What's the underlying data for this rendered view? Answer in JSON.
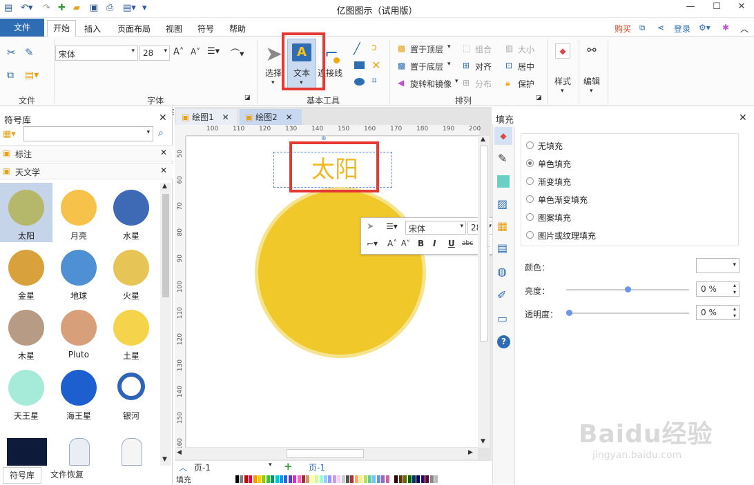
{
  "window": {
    "title": "亿图图示（试用版）",
    "minimize": "—",
    "maximize": "☐",
    "close": "✕"
  },
  "menu": {
    "file": "文件",
    "items": [
      "开始",
      "插入",
      "页面布局",
      "视图",
      "符号",
      "帮助"
    ],
    "buy": "购买",
    "login": "登录"
  },
  "ribbon": {
    "groups": {
      "file": "文件",
      "font": "字体",
      "basic_tools": "基本工具",
      "arrange": "排列"
    },
    "font_name": "宋体",
    "font_size": "28",
    "tools": {
      "select": "选择",
      "text": "文本",
      "connector": "连接线"
    },
    "arrange": {
      "bring_top": "置于顶层",
      "send_bottom": "置于底层",
      "rotate": "旋转和镜像",
      "group": "组合",
      "align": "对齐",
      "distribute": "分布",
      "size": "大小",
      "center": "居中",
      "protect": "保护"
    },
    "style": "样式",
    "edit": "编辑"
  },
  "left_panel": {
    "title": "符号库",
    "search_placeholder": "",
    "libraries": [
      "标注",
      "天文学"
    ],
    "symbols": [
      {
        "label": "太阳",
        "color": "#b5b86a"
      },
      {
        "label": "月亮",
        "color": "#f6c24a"
      },
      {
        "label": "水星",
        "color": "#3e69b4"
      },
      {
        "label": "金星",
        "color": "#d9a13c"
      },
      {
        "label": "地球",
        "color": "#4f8fd4"
      },
      {
        "label": "火星",
        "color": "#e7c456"
      },
      {
        "label": "木星",
        "color": "#b89b85"
      },
      {
        "label": "Pluto",
        "color": "#d8a07a"
      },
      {
        "label": "土星",
        "color": "#f5d34b"
      },
      {
        "label": "天王星",
        "color": "#a6ebd9"
      },
      {
        "label": "海王星",
        "color": "#1e5fcf"
      },
      {
        "label": "银河",
        "color": "#2d64b8"
      }
    ],
    "bottom_tabs": [
      "符号库",
      "文件恢复"
    ]
  },
  "doc_tabs": [
    "绘图1",
    "绘图2"
  ],
  "ruler_h": [
    "100",
    "110",
    "120",
    "130",
    "140",
    "150",
    "160",
    "170",
    "180",
    "190",
    "200"
  ],
  "ruler_v": [
    "50",
    "60",
    "70",
    "80",
    "90",
    "100",
    "110",
    "120",
    "130",
    "140",
    "150",
    "160"
  ],
  "canvas": {
    "text": "太阳",
    "text_color": "#f0b923",
    "sun_color": "#f0c829",
    "sun_ring": "#f5e38e"
  },
  "float_toolbar": {
    "font": "宋体",
    "size": "28"
  },
  "page_bar": {
    "page_select": "页-1",
    "page_tab": "页-1",
    "fill_label": "填充"
  },
  "fill_panel": {
    "title": "填充",
    "options": [
      "无填充",
      "单色填充",
      "渐变填充",
      "单色渐变填充",
      "图案填充",
      "图片或纹理填充"
    ],
    "selected": "单色填充",
    "color_label": "颜色：",
    "brightness_label": "亮度：",
    "brightness_value": "0 %",
    "transparency_label": "透明度：",
    "transparency_value": "0 %",
    "brightness_level": 0.5,
    "transparency_level": 0.0
  },
  "watermark": {
    "brand": "Baidu经验",
    "url": "jingyan.baidu.com"
  }
}
